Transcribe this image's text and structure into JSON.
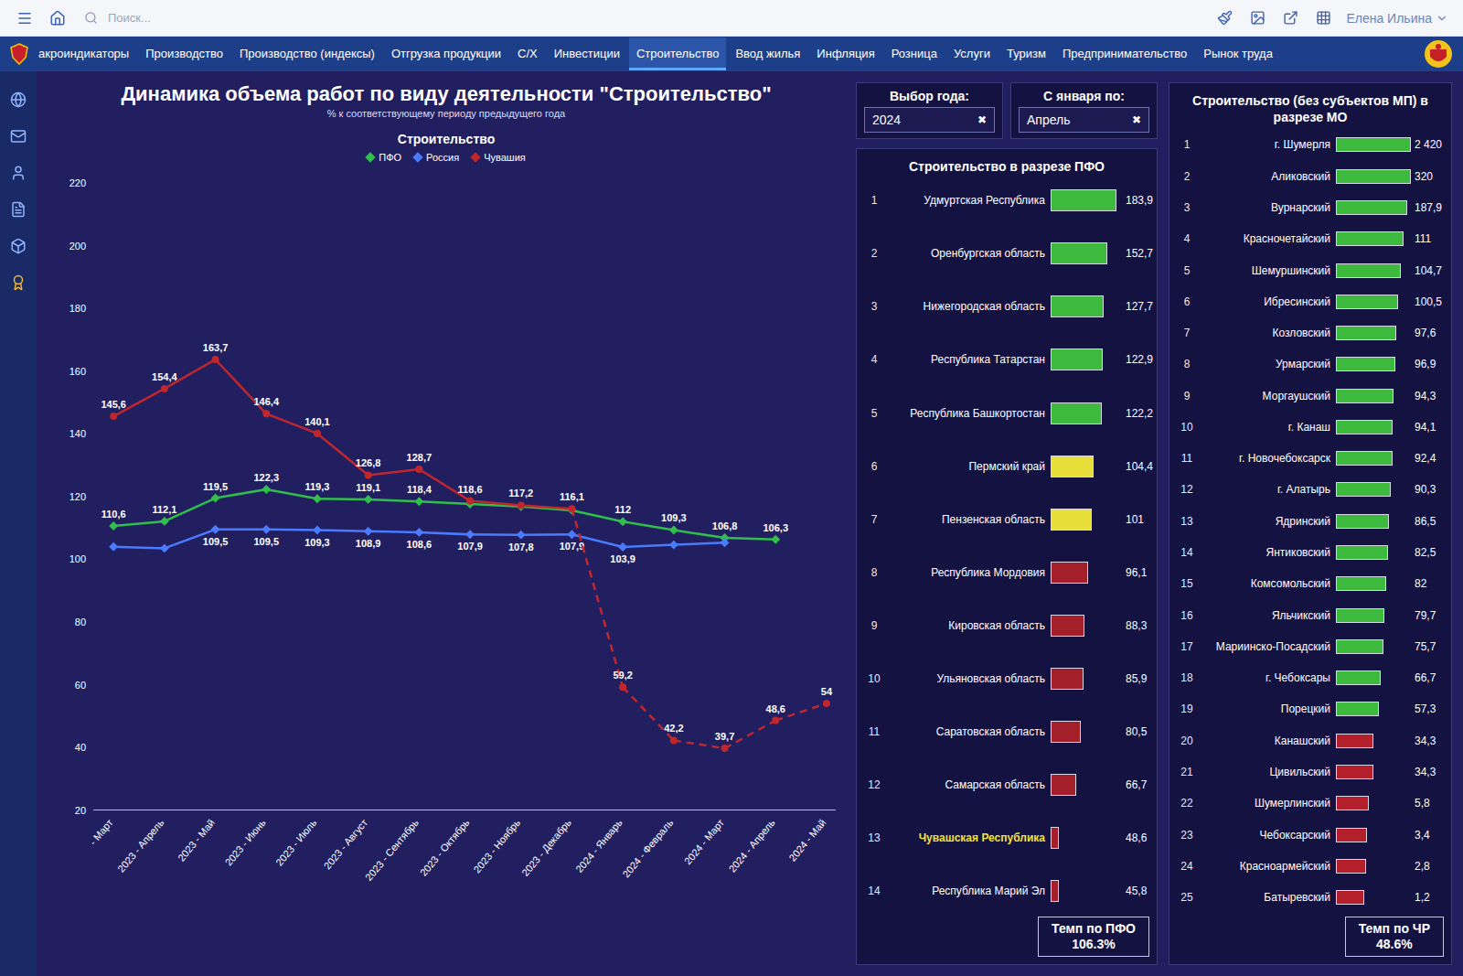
{
  "top_bar": {
    "search": {
      "placeholder": "Поиск..."
    },
    "user": "Елена Ильина"
  },
  "tabs": [
    {
      "label": "акроиндикаторы",
      "selected": false
    },
    {
      "label": "Производство",
      "selected": false
    },
    {
      "label": "Производство (индексы)",
      "selected": false
    },
    {
      "label": "Отгрузка продукции",
      "selected": false
    },
    {
      "label": "С/Х",
      "selected": false
    },
    {
      "label": "Инвестиции",
      "selected": false
    },
    {
      "label": "Строительство",
      "selected": true
    },
    {
      "label": "Ввод жилья",
      "selected": false
    },
    {
      "label": "Инфляция",
      "selected": false
    },
    {
      "label": "Розница",
      "selected": false
    },
    {
      "label": "Услуги",
      "selected": false
    },
    {
      "label": "Туризм",
      "selected": false
    },
    {
      "label": "Предпринимательство",
      "selected": false
    },
    {
      "label": "Рынок труда",
      "selected": false
    }
  ],
  "title": "Динамика объема работ по виду деятельности \"Строительство\"",
  "subtitle": "% к соответствующему периоду предыдущего года",
  "selects": [
    {
      "label": "Выбор года:",
      "value": "2024",
      "clear": "✖"
    },
    {
      "label": "С января по:",
      "value": "Апрель",
      "clear": "✖"
    }
  ],
  "chart": {
    "title": "Строительство",
    "y_min": 20,
    "y_max": 220,
    "y_ticks": [
      "220",
      "200",
      "180",
      "160",
      "140",
      "120",
      "100",
      "80",
      "60",
      "40",
      "20"
    ],
    "x_labels": [
      "- Март",
      "2023 - Апрель",
      "2023 - Май",
      "2023 - Июнь",
      "2023 - Июль",
      "2023 - Август",
      "2023 - Сентябрь",
      "2023 - Октябрь",
      "2023 - Ноябрь",
      "2023 - Декабрь",
      "2024 - Январь",
      "2024 - Февраль",
      "2024 - Март",
      "2024 - Апрель",
      "2024 - Май"
    ],
    "series": [
      {
        "name": "ПФО",
        "color": "#2fbf4a",
        "marker": "diamond",
        "label_side": "above",
        "points": [
          {
            "value": 110.6,
            "label": "110,6",
            "dashed": false
          },
          {
            "value": 112.1,
            "label": "112,1",
            "dashed": false
          },
          {
            "value": 119.5,
            "label": "119,5",
            "dashed": false
          },
          {
            "value": 122.3,
            "label": "122,3",
            "dashed": false
          },
          {
            "value": 119.3,
            "label": "119,3",
            "dashed": false
          },
          {
            "value": 119.1,
            "label": "119,1",
            "dashed": false
          },
          {
            "value": 118.4,
            "label": "118,4",
            "dashed": false
          },
          {
            "value": 117.6,
            "label": "",
            "dashed": false
          },
          {
            "value": 116.8,
            "label": "",
            "dashed": false
          },
          {
            "value": 115.6,
            "label": "",
            "dashed": false
          },
          {
            "value": 112,
            "label": "112",
            "dashed": false
          },
          {
            "value": 109.3,
            "label": "109,3",
            "dashed": false
          },
          {
            "value": 106.8,
            "label": "106,8",
            "dashed": false
          },
          {
            "value": 106.3,
            "label": "106,3",
            "dashed": false
          }
        ]
      },
      {
        "name": "Россия",
        "color": "#4a7bff",
        "marker": "diamond",
        "label_side": "below",
        "points": [
          {
            "value": 104,
            "label": "",
            "dashed": false
          },
          {
            "value": 103.5,
            "label": "",
            "dashed": false
          },
          {
            "value": 109.5,
            "label": "109,5",
            "dashed": false
          },
          {
            "value": 109.5,
            "label": "109,5",
            "dashed": false
          },
          {
            "value": 109.3,
            "label": "109,3",
            "dashed": false
          },
          {
            "value": 108.9,
            "label": "108,9",
            "dashed": false
          },
          {
            "value": 108.6,
            "label": "108,6",
            "dashed": false
          },
          {
            "value": 107.9,
            "label": "107,9",
            "dashed": false
          },
          {
            "value": 107.8,
            "label": "107,8",
            "dashed": false
          },
          {
            "value": 107.9,
            "label": "107,9",
            "dashed": false
          },
          {
            "value": 103.9,
            "label": "103,9",
            "dashed": false
          },
          {
            "value": 104.6,
            "label": "",
            "dashed": false
          },
          {
            "value": 105.3,
            "label": "",
            "dashed": false
          }
        ]
      },
      {
        "name": "Чувашия",
        "color": "#c0272d",
        "marker": "circle",
        "label_side": "above",
        "points": [
          {
            "value": 145.6,
            "label": "145,6",
            "dashed": false
          },
          {
            "value": 154.4,
            "label": "154,4",
            "dashed": false
          },
          {
            "value": 163.7,
            "label": "163,7",
            "dashed": false
          },
          {
            "value": 146.4,
            "label": "146,4",
            "dashed": false
          },
          {
            "value": 140.1,
            "label": "140,1",
            "dashed": false
          },
          {
            "value": 126.8,
            "label": "126,8",
            "dashed": false
          },
          {
            "value": 128.7,
            "label": "128,7",
            "dashed": false
          },
          {
            "value": 118.6,
            "label": "118,6",
            "dashed": false
          },
          {
            "value": 117.2,
            "label": "117,2",
            "dashed": false
          },
          {
            "value": 116.1,
            "label": "116,1",
            "dashed": false
          },
          {
            "value": 59.2,
            "label": "59,2",
            "dashed": true
          },
          {
            "value": 42.2,
            "label": "42,2",
            "dashed": true
          },
          {
            "value": 39.7,
            "label": "39,7",
            "dashed": true
          },
          {
            "value": 48.6,
            "label": "48,6",
            "dashed": true
          },
          {
            "value": 54,
            "label": "54",
            "dashed": true
          }
        ]
      }
    ]
  },
  "pfo_panel": {
    "title": "Строительство в разрезе ПФО",
    "items": [
      {
        "rank": "1",
        "name": "Удмуртская Республика",
        "value": "183,9",
        "level": 0.92,
        "color": "#3dba3d",
        "highlighted": false
      },
      {
        "rank": "2",
        "name": "Оренбургская область",
        "value": "152,7",
        "level": 0.8,
        "color": "#3dba3d",
        "highlighted": false
      },
      {
        "rank": "3",
        "name": "Нижегородская область",
        "value": "127,7",
        "level": 0.74,
        "color": "#3dba3d",
        "highlighted": false
      },
      {
        "rank": "4",
        "name": "Республика Татарстан",
        "value": "122,9",
        "level": 0.73,
        "color": "#3dba3d",
        "highlighted": false
      },
      {
        "rank": "5",
        "name": "Республика Башкортостан",
        "value": "122,2",
        "level": 0.72,
        "color": "#3dba3d",
        "highlighted": false
      },
      {
        "rank": "6",
        "name": "Пермский край",
        "value": "104,4",
        "level": 0.6,
        "color": "#e6df3a",
        "highlighted": false
      },
      {
        "rank": "7",
        "name": "Пензенская область",
        "value": "101",
        "level": 0.58,
        "color": "#e6df3a",
        "highlighted": false
      },
      {
        "rank": "8",
        "name": "Республика Мордовия",
        "value": "96,1",
        "level": 0.52,
        "color": "#a3202b",
        "highlighted": false
      },
      {
        "rank": "9",
        "name": "Кировская область",
        "value": "88,3",
        "level": 0.48,
        "color": "#a3202b",
        "highlighted": false
      },
      {
        "rank": "10",
        "name": "Ульяновская область",
        "value": "85,9",
        "level": 0.46,
        "color": "#a3202b",
        "highlighted": false
      },
      {
        "rank": "11",
        "name": "Саратовская область",
        "value": "80,5",
        "level": 0.42,
        "color": "#a3202b",
        "highlighted": false
      },
      {
        "rank": "12",
        "name": "Самарская область",
        "value": "66,7",
        "level": 0.36,
        "color": "#a3202b",
        "highlighted": false
      },
      {
        "rank": "13",
        "name": "Чувашская Республика",
        "value": "48,6",
        "level": 0.12,
        "color": "#a3202b",
        "highlighted": true
      },
      {
        "rank": "14",
        "name": "Республика Марий Эл",
        "value": "45,8",
        "level": 0.11,
        "color": "#a3202b",
        "highlighted": false
      }
    ],
    "footer_label": "Темп по ПФО",
    "footer_value": "106.3%"
  },
  "mo_panel": {
    "title": "Строительство (без субъектов МП) в разрезе МО",
    "items": [
      {
        "rank": "1",
        "name": "г. Шумерля",
        "value": "2 420",
        "level": 1,
        "color": "#3dba3d"
      },
      {
        "rank": "2",
        "name": "Аликовский",
        "value": "320",
        "level": 1,
        "color": "#3dba3d"
      },
      {
        "rank": "3",
        "name": "Вурнарский",
        "value": "187,9",
        "level": 0.95,
        "color": "#3dba3d"
      },
      {
        "rank": "4",
        "name": "Красночетайский",
        "value": "111",
        "level": 0.9,
        "color": "#3dba3d"
      },
      {
        "rank": "5",
        "name": "Шемуршинский",
        "value": "104,7",
        "level": 0.86,
        "color": "#3dba3d"
      },
      {
        "rank": "6",
        "name": "Ибресинский",
        "value": "100,5",
        "level": 0.83,
        "color": "#3dba3d"
      },
      {
        "rank": "7",
        "name": "Козловский",
        "value": "97,6",
        "level": 0.8,
        "color": "#3dba3d"
      },
      {
        "rank": "8",
        "name": "Урмарский",
        "value": "96,9",
        "level": 0.79,
        "color": "#3dba3d"
      },
      {
        "rank": "9",
        "name": "Моргаушский",
        "value": "94,3",
        "level": 0.77,
        "color": "#3dba3d"
      },
      {
        "rank": "10",
        "name": "г. Канаш",
        "value": "94,1",
        "level": 0.76,
        "color": "#3dba3d"
      },
      {
        "rank": "11",
        "name": "г. Новочебоксарск",
        "value": "92,4",
        "level": 0.75,
        "color": "#3dba3d"
      },
      {
        "rank": "12",
        "name": "г. Алатырь",
        "value": "90,3",
        "level": 0.73,
        "color": "#3dba3d"
      },
      {
        "rank": "13",
        "name": "Ядринский",
        "value": "86,5",
        "level": 0.71,
        "color": "#3dba3d"
      },
      {
        "rank": "14",
        "name": "Янтиковский",
        "value": "82,5",
        "level": 0.69,
        "color": "#3dba3d"
      },
      {
        "rank": "15",
        "name": "Комсомольский",
        "value": "82",
        "level": 0.67,
        "color": "#3dba3d"
      },
      {
        "rank": "16",
        "name": "Яльчикский",
        "value": "79,7",
        "level": 0.65,
        "color": "#3dba3d"
      },
      {
        "rank": "17",
        "name": "Мариинско-Посадский",
        "value": "75,7",
        "level": 0.63,
        "color": "#3dba3d"
      },
      {
        "rank": "18",
        "name": "г. Чебоксары",
        "value": "66,7",
        "level": 0.6,
        "color": "#3dba3d"
      },
      {
        "rank": "19",
        "name": "Порецкий",
        "value": "57,3",
        "level": 0.57,
        "color": "#3dba3d"
      },
      {
        "rank": "20",
        "name": "Канашский",
        "value": "34,3",
        "level": 0.5,
        "color": "#b3202b"
      },
      {
        "rank": "21",
        "name": "Цивильский",
        "value": "34,3",
        "level": 0.5,
        "color": "#b3202b"
      },
      {
        "rank": "22",
        "name": "Шумерлинский",
        "value": "5,8",
        "level": 0.44,
        "color": "#b3202b"
      },
      {
        "rank": "23",
        "name": "Чебоксарский",
        "value": "3,4",
        "level": 0.42,
        "color": "#b3202b"
      },
      {
        "rank": "24",
        "name": "Красноармейский",
        "value": "2,8",
        "level": 0.4,
        "color": "#b3202b"
      },
      {
        "rank": "25",
        "name": "Батыревский",
        "value": "1,2",
        "level": 0.38,
        "color": "#b3202b"
      }
    ],
    "footer_label": "Темп по ЧР",
    "footer_value": "48.6%"
  }
}
